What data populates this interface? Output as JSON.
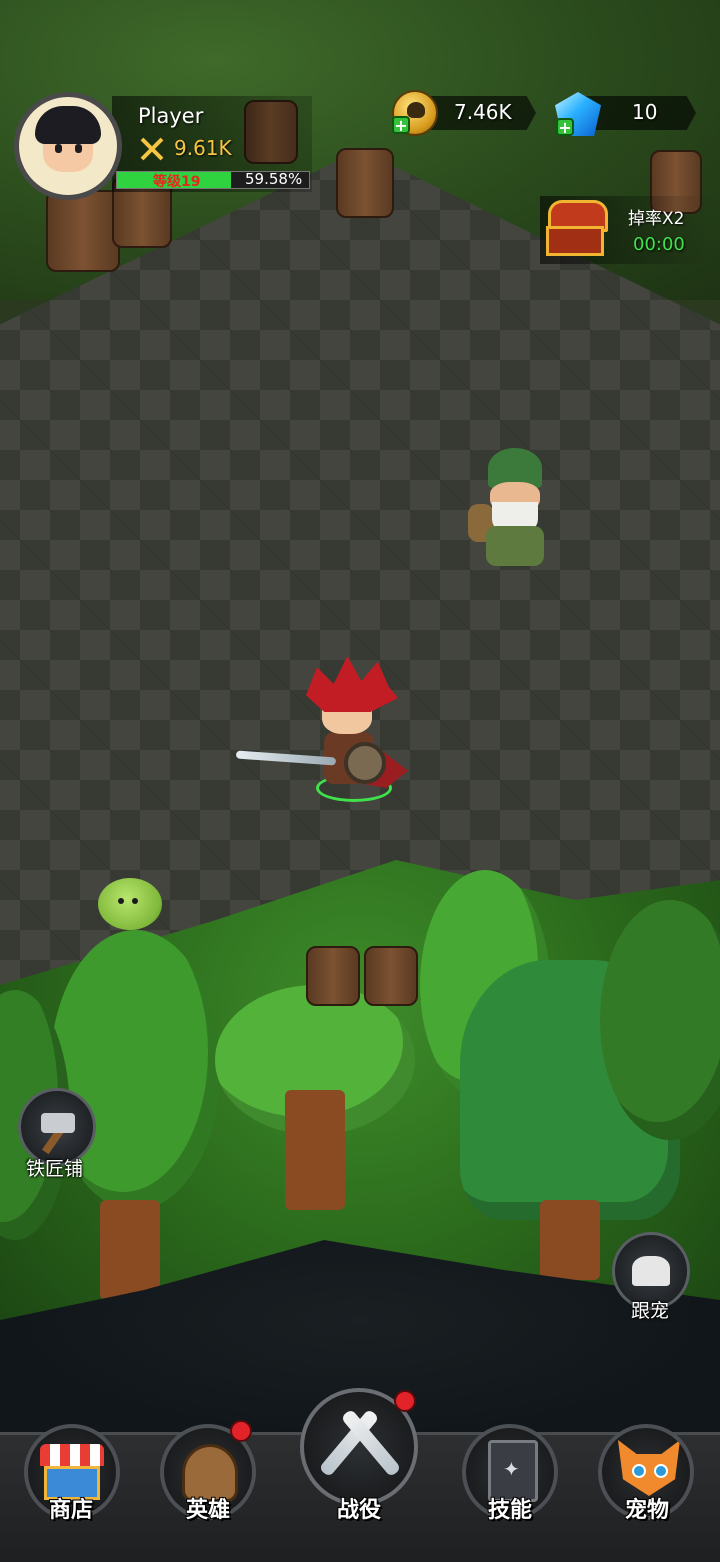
{
  "player": {
    "name": "Player",
    "power": "9.61K",
    "level_label": "等级19",
    "level_progress_text": "59.58%",
    "level_progress": 0.5958
  },
  "resources": {
    "gold": "7.46K",
    "gems": "10"
  },
  "bonus": {
    "label": "掉率X2",
    "timer": "00:00"
  },
  "side_buttons": {
    "blacksmith": "铁匠铺",
    "follow_pet": "跟宠"
  },
  "nav": {
    "shop": "商店",
    "heroes": "英雄",
    "campaign": "战役",
    "skills": "技能",
    "pets": "宠物"
  },
  "colors": {
    "level_fill": "#2fd23f",
    "power_text": "#f6c544",
    "timer_text": "#3fe24b",
    "notification": "#e2232a"
  }
}
